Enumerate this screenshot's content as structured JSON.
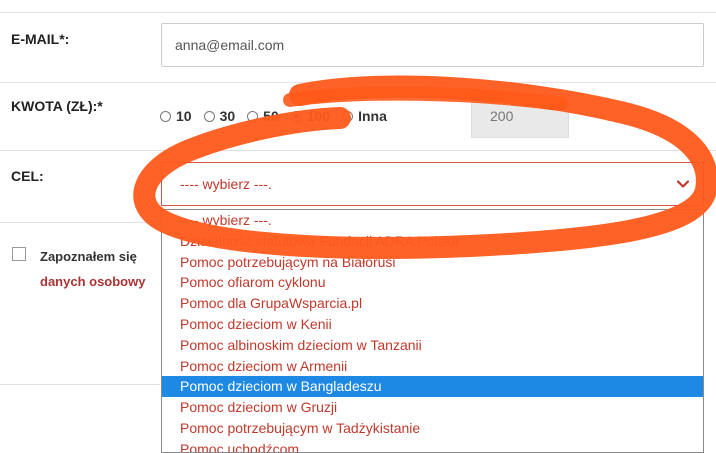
{
  "form": {
    "email": {
      "label": "E-MAIL*:",
      "value": "anna@email.com"
    },
    "amount": {
      "label": "KWOTA (ZŁ):*",
      "options": [
        "10",
        "30",
        "50",
        "100",
        "Inna"
      ],
      "selected": "100",
      "other_value": "200"
    },
    "goal": {
      "label": "CEL:",
      "selected_display": "---- wybierz ---.",
      "options": [
        "---- wybierz ---.",
        "Działalność statutowa Fundacji ADRA Polska",
        "Pomoc potrzebującym na Białorusi",
        "Pomoc ofiarom cyklonu",
        "Pomoc dla GrupaWsparcia.pl",
        "Pomoc dzieciom w Kenii",
        "Pomoc albinoskim dzieciom w Tanzanii",
        "Pomoc dzieciom w Armenii",
        "Pomoc dzieciom w Bangladeszu",
        "Pomoc dzieciom w Gruzji",
        "Pomoc potrzebującym w Tadżykistanie",
        "Pomoc uchodźcom"
      ],
      "highlighted": "Pomoc dzieciom w Bangladeszu"
    },
    "consent": {
      "line1": "Zapoznałem się",
      "line2": "danych osobowy"
    }
  },
  "colors": {
    "accent_red": "#c0392b",
    "select_highlight": "#1e88e5",
    "annotation_orange": "#ff5a1a"
  },
  "icons": {
    "dropdown": "chevron-down-icon"
  }
}
